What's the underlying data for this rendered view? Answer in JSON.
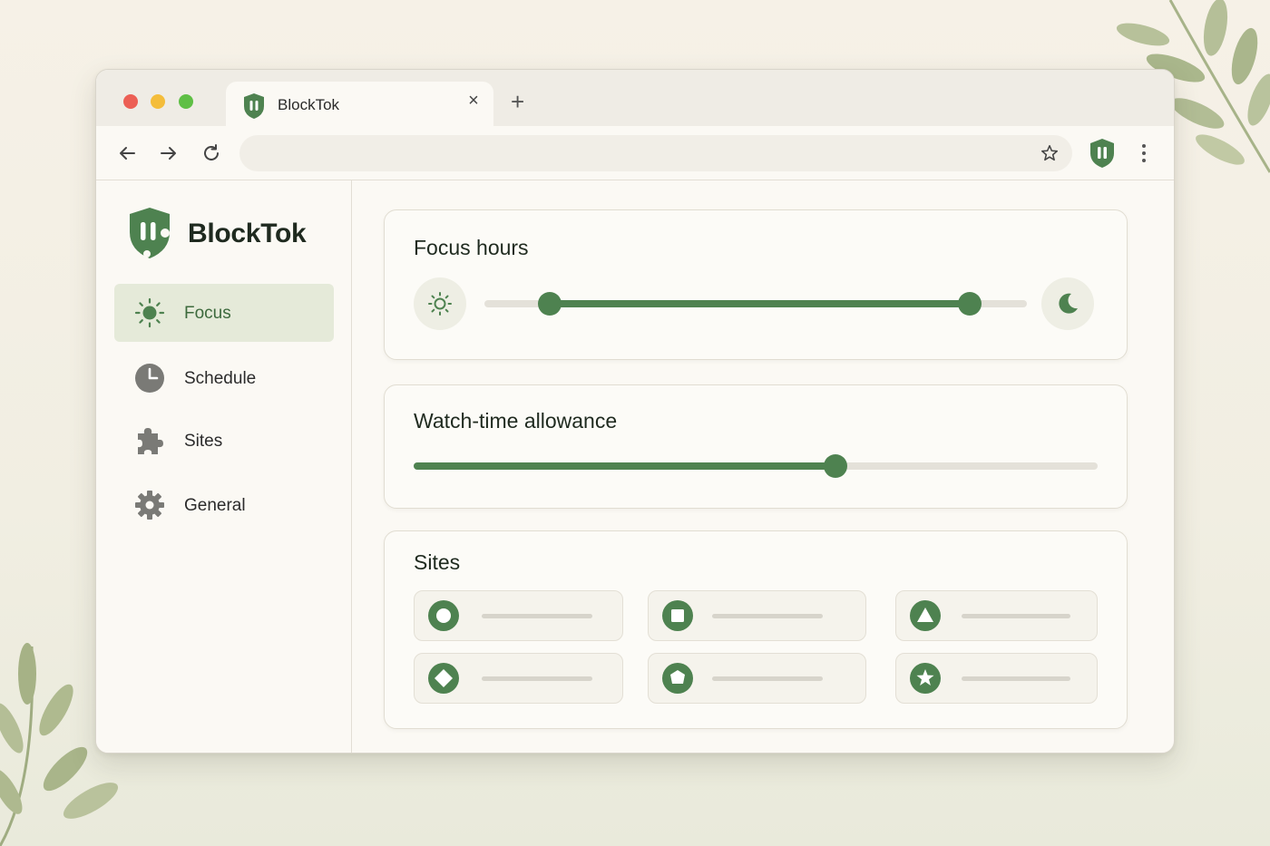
{
  "browser": {
    "tab": {
      "title": "BlockTok",
      "close_glyph": "×"
    },
    "new_tab_glyph": "+",
    "omnibox": {
      "value": ""
    }
  },
  "sidebar": {
    "brand": "BlockTok",
    "items": [
      {
        "label": "Focus",
        "icon": "sun-icon",
        "active": true
      },
      {
        "label": "Schedule",
        "icon": "clock-icon",
        "active": false
      },
      {
        "label": "Sites",
        "icon": "puzzle-icon",
        "active": false
      },
      {
        "label": "General",
        "icon": "gear-icon",
        "active": false
      }
    ]
  },
  "focus_hours": {
    "title": "Focus hours",
    "start_icon": "sun-icon",
    "end_icon": "moon-icon",
    "range_start_fraction": 0.12,
    "range_end_fraction": 0.895
  },
  "watch_time": {
    "title": "Watch-time allowance",
    "value_fraction": 0.617
  },
  "sites": {
    "title": "Sites",
    "items": [
      {
        "icon": "circle-icon"
      },
      {
        "icon": "square-icon"
      },
      {
        "icon": "triangle-icon"
      },
      {
        "icon": "diamond-icon"
      },
      {
        "icon": "hexagon-icon"
      },
      {
        "icon": "star-icon"
      }
    ]
  },
  "colors": {
    "accent": "#4e8250",
    "accent_light": "#e5ead9",
    "track": "#e4e1d9",
    "background": "#f6f1e7"
  }
}
